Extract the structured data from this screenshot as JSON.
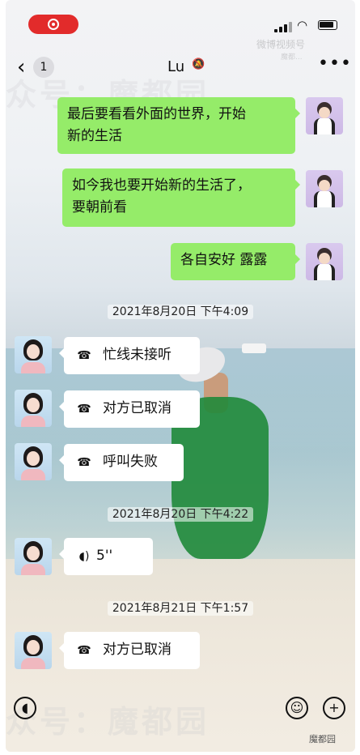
{
  "status_bar": {
    "recording": "recording-icon"
  },
  "watermark": {
    "weibo": "微博视频号",
    "weibo_sub": "魔都...",
    "corner": "魔都园",
    "big_top": "众号：魔都园",
    "big_bottom": "众号：魔都园"
  },
  "nav": {
    "back_count": "1",
    "title": "Lu",
    "mute_icon": "bell-slash-icon",
    "more": "•••"
  },
  "messages_out": [
    {
      "text_line1": "最后要看看外面的世界，开始",
      "text_line2": "新的生活"
    },
    {
      "text_line1": "如今我也要开始新的生活了，",
      "text_line2": "要朝前看"
    },
    {
      "text_line1": "各自安好 露露"
    }
  ],
  "timestamps": [
    "2021年8月20日 下午4:09",
    "2021年8月20日 下午4:22",
    "2021年8月21日 下午1:57"
  ],
  "calls": [
    {
      "icon": "phone-hangup-icon",
      "text": "忙线未接听"
    },
    {
      "icon": "phone-hangup-icon",
      "text": "对方已取消"
    },
    {
      "icon": "phone-hangup-icon",
      "text": "呼叫失败"
    },
    {
      "icon": "voice-icon",
      "text": "5''"
    },
    {
      "icon": "phone-hangup-icon",
      "text": "对方已取消"
    }
  ],
  "input_bar": {
    "voice": "voice-icon",
    "emoji": "emoji-icon",
    "plus": "+"
  }
}
